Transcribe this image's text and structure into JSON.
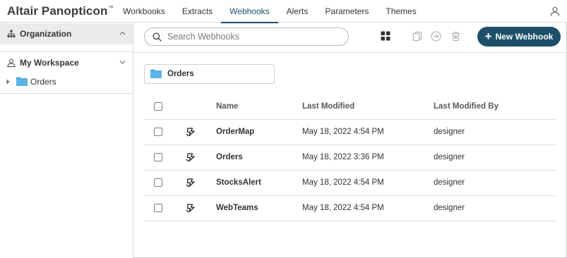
{
  "brand": {
    "name": "Altair Panopticon",
    "tm": "™"
  },
  "nav": {
    "items": [
      {
        "label": "Workbooks",
        "active": false
      },
      {
        "label": "Extracts",
        "active": false
      },
      {
        "label": "Webhooks",
        "active": true
      },
      {
        "label": "Alerts",
        "active": false
      },
      {
        "label": "Parameters",
        "active": false
      },
      {
        "label": "Themes",
        "active": false
      }
    ]
  },
  "sidebar": {
    "organization": {
      "label": "Organization",
      "icon": "hierarchy-icon"
    },
    "workspace": {
      "label": "My Workspace",
      "icon": "user-icon"
    },
    "tree": [
      {
        "label": "Orders",
        "icon": "folder-icon"
      }
    ]
  },
  "toolbar": {
    "search_placeholder": "Search Webhooks",
    "new_button_label": "New Webhook",
    "new_button_plus": "+"
  },
  "folder": {
    "label": "Orders"
  },
  "table": {
    "headers": {
      "name": "Name",
      "last_modified": "Last Modified",
      "last_modified_by": "Last Modified By"
    },
    "rows": [
      {
        "name": "OrderMap",
        "last_modified": "May 18, 2022 4:54 PM",
        "last_modified_by": "designer"
      },
      {
        "name": "Orders",
        "last_modified": "May 18, 2022 3:36 PM",
        "last_modified_by": "designer"
      },
      {
        "name": "StocksAlert",
        "last_modified": "May 18, 2022 4:54 PM",
        "last_modified_by": "designer"
      },
      {
        "name": "WebTeams",
        "last_modified": "May 18, 2022 4:54 PM",
        "last_modified_by": "designer"
      }
    ]
  },
  "colors": {
    "accent": "#1e4f68",
    "folder": "#4fa8dc",
    "active_tab": "#1a4f6e"
  }
}
